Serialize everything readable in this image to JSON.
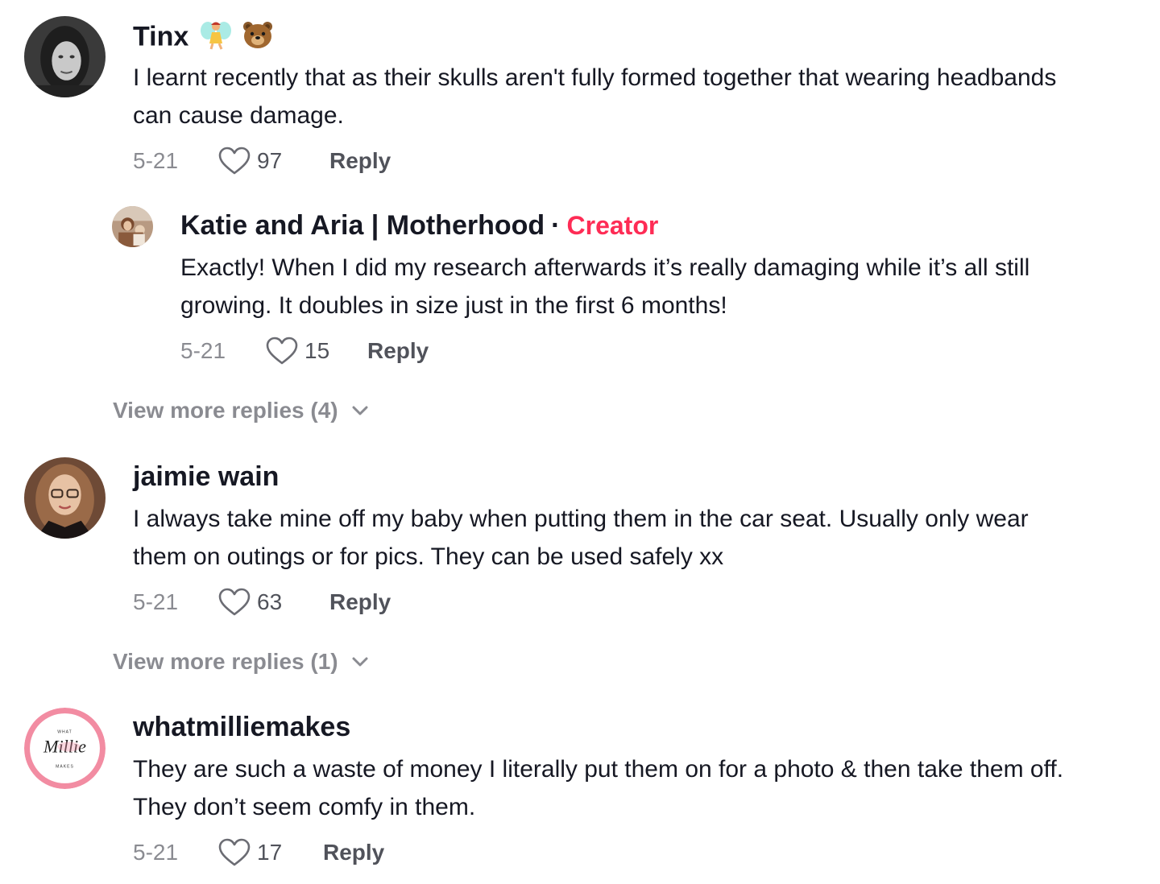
{
  "colors": {
    "text": "#161823",
    "muted": "#8a8b91",
    "creator_accent": "#fe2c55",
    "background": "#ffffff"
  },
  "comments": [
    {
      "username": "Tinx",
      "username_emoji": [
        "fairy-emoji",
        "bear-emoji"
      ],
      "text": "I learnt recently that as their skulls aren't fully formed together that wearing headbands can cause damage.",
      "date": "5-21",
      "likes": "97",
      "reply_label": "Reply",
      "replies": [
        {
          "username": "Katie and Aria | Motherhood",
          "separator": "·",
          "badge": "Creator",
          "text": "Exactly! When I did my research afterwards it’s really damaging while it’s all still growing. It doubles in size just in the first 6 months!",
          "date": "5-21",
          "likes": "15",
          "reply_label": "Reply"
        }
      ],
      "view_more": "View more replies (4)"
    },
    {
      "username": "jaimie wain",
      "text": "I always take mine off my baby when putting them in the car seat. Usually only wear them on outings or for pics. They can be used safely xx",
      "date": "5-21",
      "likes": "63",
      "reply_label": "Reply",
      "view_more": "View more replies (1)"
    },
    {
      "username": "whatmilliemakes",
      "avatar_logo": {
        "top": "WHAT",
        "script": "Millie",
        "bottom": "MAKES"
      },
      "text": "They are such a waste of money I literally put them on for a photo & then take them off. They don’t seem comfy in them.",
      "date": "5-21",
      "likes": "17",
      "reply_label": "Reply"
    }
  ]
}
